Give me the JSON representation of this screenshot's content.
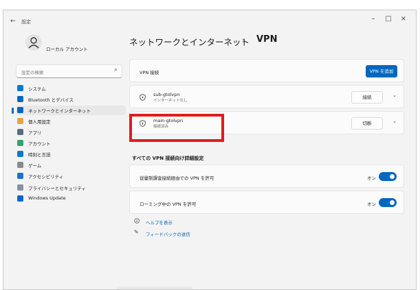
{
  "window": {
    "back_icon": "arrow-left-icon",
    "title": "設定",
    "controls": [
      "–",
      "□",
      "×"
    ]
  },
  "sidebar": {
    "account_name": "ローカル アカウント",
    "search_placeholder": "設定の検索",
    "items": [
      {
        "label": "システム",
        "icon": "monitor-icon",
        "color": "#0078d4"
      },
      {
        "label": "Bluetooth とデバイス",
        "icon": "bluetooth-icon",
        "color": "#0067c0"
      },
      {
        "label": "ネットワークとインターネット",
        "icon": "wifi-icon",
        "color": "#0067c0",
        "active": true
      },
      {
        "label": "個人用設定",
        "icon": "brush-icon",
        "color": "#e8a33c"
      },
      {
        "label": "アプリ",
        "icon": "apps-icon",
        "color": "#5a6b80"
      },
      {
        "label": "アカウント",
        "icon": "person-icon",
        "color": "#2fa56b"
      },
      {
        "label": "時刻と言語",
        "icon": "globe-clock-icon",
        "color": "#0a7ac9"
      },
      {
        "label": "ゲーム",
        "icon": "gamepad-icon",
        "color": "#8a8a8a"
      },
      {
        "label": "アクセシビリティ",
        "icon": "accessibility-icon",
        "color": "#1f6fd1"
      },
      {
        "label": "プライバシーとセキュリティ",
        "icon": "shield-icon",
        "color": "#8a8fa0"
      },
      {
        "label": "Windows Update",
        "icon": "update-icon",
        "color": "#0a66c2"
      }
    ]
  },
  "main": {
    "breadcrumb_parent": "ネットワークとインターネット",
    "breadcrumb_separator": "›",
    "breadcrumb_current": "VPN",
    "vpn_connections": {
      "label": "VPN 接続",
      "add_button": "VPN を追加"
    },
    "vpns": [
      {
        "name": "sub-gtolvpn",
        "status": "インターネットなし",
        "action": "接続"
      },
      {
        "name": "main-gtolvpn",
        "status": "接続済み",
        "action": "切断"
      }
    ],
    "advanced_title": "すべての VPN 接続向け詳細設定",
    "settings": [
      {
        "label": "従量制課金接続経由での VPN を許可",
        "state": "オン"
      },
      {
        "label": "ローミング中の VPN を許可",
        "state": "オン"
      }
    ],
    "help_link": "ヘルプを表示",
    "feedback_link": "フィードバックの送信"
  },
  "accent_color": "#0067c0",
  "highlight_color": "#e31b1b"
}
